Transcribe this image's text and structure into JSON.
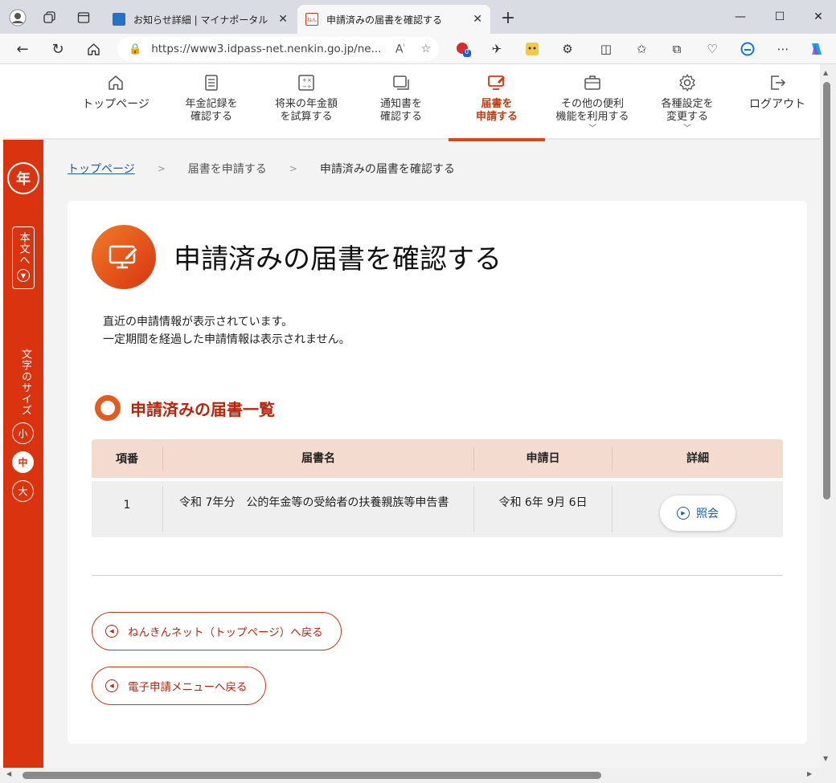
{
  "browser": {
    "tabs": [
      {
        "title": "お知らせ詳細 | マイナポータル",
        "active": false
      },
      {
        "title": "申請済みの届書を確認する",
        "active": true
      }
    ],
    "url": "https://www3.idpass-net.nenkin.go.jp/ne...",
    "new_tab": "+",
    "ext_badge": "0"
  },
  "global_nav": [
    {
      "id": "top",
      "label": "トップページ",
      "icon": "home-icon"
    },
    {
      "id": "records",
      "label": "年金記録を\n確認する",
      "icon": "document-list-icon"
    },
    {
      "id": "estimate",
      "label": "将来の年金額\nを試算する",
      "icon": "calculator-icon"
    },
    {
      "id": "notices",
      "label": "通知書を\n確認する",
      "icon": "documents-stack-icon"
    },
    {
      "id": "apply",
      "label": "届書を\n申請する",
      "icon": "monitor-pen-icon",
      "active": true
    },
    {
      "id": "other",
      "label": "その他の便利\n機能を利用する",
      "icon": "toolbox-icon",
      "dropdown": true
    },
    {
      "id": "settings",
      "label": "各種設定を\n変更する",
      "icon": "gear-icon",
      "dropdown": true
    },
    {
      "id": "logout",
      "label": "ログアウト",
      "icon": "logout-icon"
    }
  ],
  "sidebar": {
    "skip_label": "本文へ",
    "text_size_label": "文字のサイズ",
    "sizes": [
      {
        "label": "小",
        "active": false
      },
      {
        "label": "中",
        "active": true
      },
      {
        "label": "大",
        "active": false
      }
    ]
  },
  "breadcrumb": {
    "home": "トップページ",
    "parent": "届書を申請する",
    "current": "申請済みの届書を確認する"
  },
  "main": {
    "title": "申請済みの届書を確認する",
    "lead_line1": "直近の申請情報が表示されています。",
    "lead_line2": "一定期間を経過した申請情報は表示されません。",
    "section_title": "申請済みの届書一覧",
    "table": {
      "headers": [
        "項番",
        "届書名",
        "申請日",
        "詳細"
      ],
      "rows": [
        {
          "no": "1",
          "name": "令和 7年分　公的年金等の受給者の扶養親族等申告書",
          "date": "令和 6年 9月 6日",
          "action": "照会"
        }
      ]
    },
    "back_top": "ねんきんネット（トップページ）へ戻る",
    "back_menu": "電子申請メニューへ戻る"
  },
  "colors": {
    "brand": "#d9340f",
    "accent_text": "#b8250c",
    "table_header_bg": "#f4dbd0",
    "link": "#1a5fa8"
  }
}
